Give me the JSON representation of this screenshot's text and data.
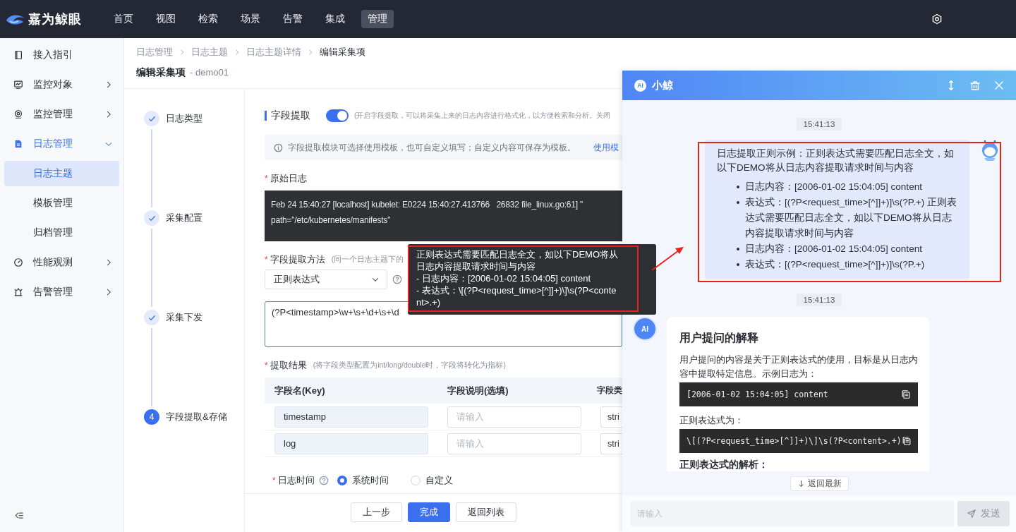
{
  "top_nav": {
    "logo": "嘉为鲸眼",
    "items": [
      {
        "label": "首页",
        "selected": false
      },
      {
        "label": "视图",
        "selected": false
      },
      {
        "label": "检索",
        "selected": false
      },
      {
        "label": "场景",
        "selected": false
      },
      {
        "label": "告警",
        "selected": false
      },
      {
        "label": "集成",
        "selected": false
      },
      {
        "label": "管理",
        "selected": true
      }
    ]
  },
  "sidebar": {
    "items": [
      {
        "label": "接入指引",
        "selected": false
      },
      {
        "label": "监控对象",
        "selected": false,
        "expanded": false
      },
      {
        "label": "监控管理",
        "selected": false,
        "expanded": false
      },
      {
        "label": "日志管理",
        "selected": false,
        "expanded": true,
        "children": [
          {
            "label": "日志主题",
            "selected": true
          },
          {
            "label": "模板管理",
            "selected": false
          },
          {
            "label": "归档管理",
            "selected": false
          }
        ]
      },
      {
        "label": "性能观测",
        "selected": false,
        "expanded": false
      },
      {
        "label": "告警管理",
        "selected": false,
        "expanded": false
      }
    ]
  },
  "breadcrumb": [
    "日志管理",
    "日志主题",
    "日志主题详情",
    "编辑采集项"
  ],
  "page_title": {
    "title": "编辑采集项",
    "subtitle": "- demo01"
  },
  "steps": [
    {
      "label": "日志类型",
      "completed": true
    },
    {
      "label": "采集配置",
      "completed": true
    },
    {
      "label": "采集下发",
      "completed": true
    },
    {
      "label": "字段提取&存储",
      "completed": false,
      "number": "4"
    }
  ],
  "form": {
    "section_title": "字段提取",
    "extract_toggle": {
      "on": true,
      "hint": "(开启字段提取，可以将采集上来的日志内容进行格式化，以方便检索和分析。关闭"
    },
    "info": {
      "text": "字段提取模块可选择使用模板，也可自定义填写；自定义内容可保存为模板。",
      "link": "使用模"
    },
    "raw_log": {
      "required_mark": "*",
      "label": "原始日志",
      "lines": [
        "Feb 24 15:40:27 [localhost] kubelet: E0224 15:40:27.413766   26832 file_linux.go:61] \"",
        "path=\"/etc/kubernetes/manifests\""
      ]
    },
    "method": {
      "required_mark": "*",
      "label": "字段提取方法",
      "hint": "(同一个日志主题下的",
      "value": "正则表达式",
      "expression": "(?P<timestamp>\\w+\\s+\\d+\\s+\\d"
    },
    "result": {
      "required_mark": "*",
      "label": "提取结果",
      "hint": "(将字段类型配置为int/long/double时，字段将转化为指标)",
      "columns": [
        "字段名(Key)",
        "字段说明(选填)",
        "字段类"
      ],
      "rows": [
        {
          "key": "timestamp",
          "description_placeholder": "请输入",
          "type": "stri"
        },
        {
          "key": "log",
          "description_placeholder": "请输入",
          "type": "stri"
        }
      ]
    },
    "log_time": {
      "required_mark": "*",
      "label": "日志时间",
      "options": [
        {
          "label": "系统时间",
          "selected": true
        },
        {
          "label": "自定义",
          "selected": false
        }
      ]
    },
    "buttons": [
      {
        "label": "上一步",
        "primary": false
      },
      {
        "label": "完成",
        "primary": true
      },
      {
        "label": "返回列表",
        "primary": false
      }
    ]
  },
  "tooltip": {
    "lines": [
      "正则表达式需要匹配日志全文，如以下DEMO将从日志内容提取请求时间与内容",
      "- 日志内容：[2006-01-02 15:04:05] content",
      "- 表达式：\\[(?P<request_time>[^]]+)\\]\\s(?P<content>.+)"
    ]
  },
  "chat": {
    "badge": "AI",
    "title": "小鲸",
    "messages": [
      {
        "kind": "time",
        "text": "15:41:13"
      },
      {
        "kind": "user",
        "text": "日志提取正则示例：正则表达式需要匹配日志全文，如以下DEMO将从日志内容提取请求时间与内容",
        "bullets": [
          "日志内容：[2006-01-02 15:04:05] content",
          "表达式：[(?P<request_time>[^]]+)]\\s(?P.+) 正则表达式需要匹配日志全文，如以下DEMO将从日志内容提取请求时间与内容",
          "日志内容：[2006-01-02 15:04:05] content",
          "表达式：[(?P<request_time>[^]]+)]\\s(?P.+)"
        ]
      },
      {
        "kind": "time",
        "text": "15:41:13"
      },
      {
        "kind": "ai",
        "avatar": "AI",
        "blocks": [
          {
            "kind": "heading",
            "text": "用户提问的解释"
          },
          {
            "kind": "paragraph",
            "text": "用户提问的内容是关于正则表达式的使用，目标是从日志内容中提取特定信息。示例日志为："
          },
          {
            "kind": "code",
            "text": "[2006-01-02 15:04:05] content"
          },
          {
            "kind": "paragraph",
            "text": "正则表达式为："
          },
          {
            "kind": "code",
            "text": "\\[(?P<request_time>[^]]+)\\]\\s(?P<content>.+)"
          },
          {
            "kind": "subheading",
            "text": "正则表达式的解析："
          }
        ]
      }
    ],
    "back_to_latest": "返回最新",
    "input_placeholder": "请输入",
    "send": {
      "label": "发送",
      "disabled": true
    }
  }
}
